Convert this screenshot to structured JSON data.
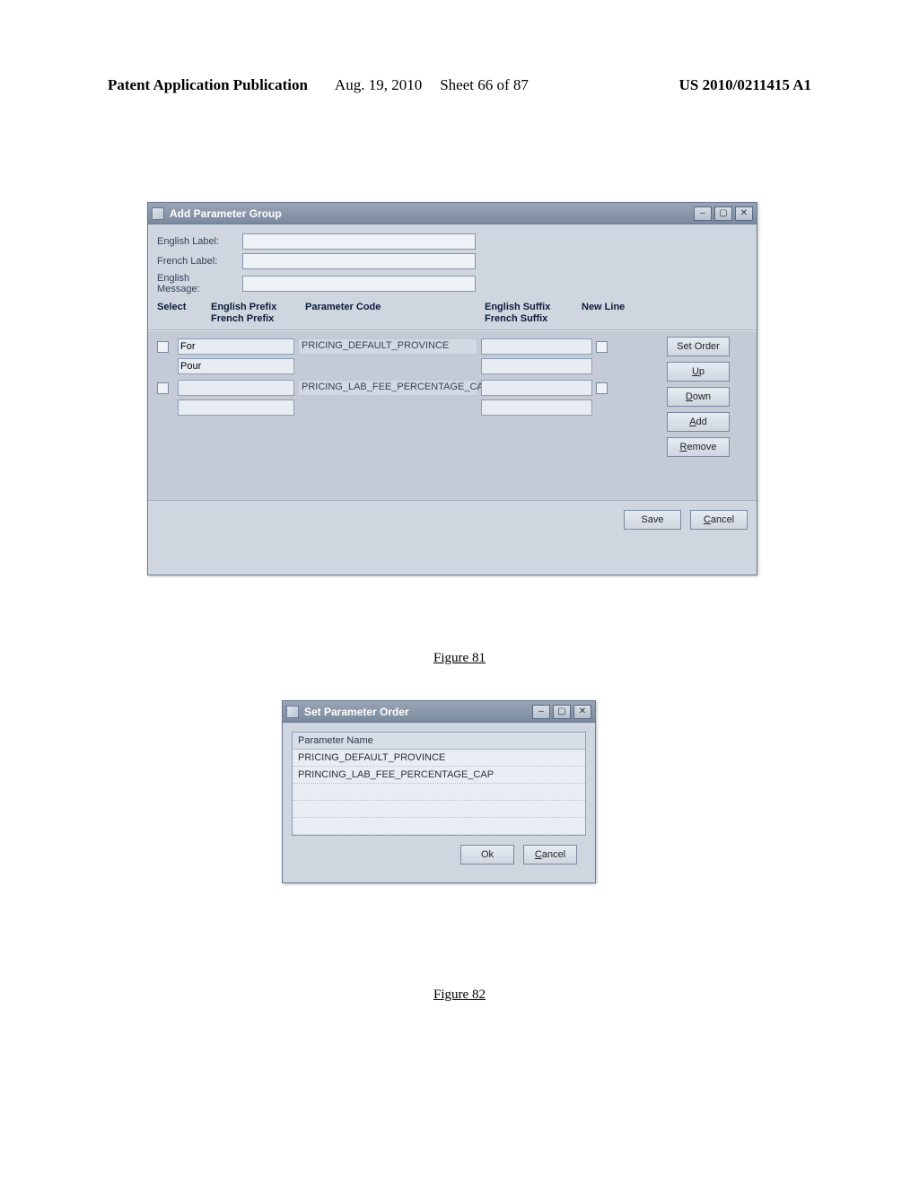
{
  "header": {
    "publication": "Patent Application Publication",
    "date": "Aug. 19, 2010",
    "sheet": "Sheet 66 of 87",
    "pubnum": "US 2010/0211415 A1"
  },
  "captions": {
    "fig81": "Figure 81",
    "fig82": "Figure 82"
  },
  "dlg1": {
    "title": "Add Parameter Group",
    "labels": {
      "english_label": "English Label:",
      "french_label": "French Label:",
      "english_message_l1": "English",
      "english_message_l2": "Message:"
    },
    "headers": {
      "select": "Select",
      "english_prefix": "English Prefix",
      "french_prefix": "French Prefix",
      "parameter_code": "Parameter Code",
      "english_suffix": "English Suffix",
      "french_suffix": "French Suffix",
      "new_line": "New Line"
    },
    "rows": [
      {
        "english_prefix": "For",
        "french_prefix": "Pour",
        "parameter_code": "PRICING_DEFAULT_PROVINCE",
        "english_suffix": "",
        "french_suffix": ""
      },
      {
        "english_prefix": "",
        "french_prefix": "",
        "parameter_code": "PRICING_LAB_FEE_PERCENTAGE_CAP",
        "english_suffix": "",
        "french_suffix": ""
      }
    ],
    "buttons": {
      "set_order": "Set Order",
      "up_u": "U",
      "up_rest": "p",
      "down_u": "D",
      "down_rest": "own",
      "add_u": "A",
      "add_rest": "dd",
      "remove_u": "R",
      "remove_rest": "emove",
      "save": "Save",
      "cancel_u": "C",
      "cancel_rest": "ancel"
    }
  },
  "dlg2": {
    "title": "Set Parameter Order",
    "list_header": "Parameter Name",
    "items": [
      "PRICING_DEFAULT_PROVINCE",
      "PRINCING_LAB_FEE_PERCENTAGE_CAP",
      "",
      "",
      ""
    ],
    "buttons": {
      "ok": "Ok",
      "cancel_u": "C",
      "cancel_rest": "ancel"
    }
  }
}
